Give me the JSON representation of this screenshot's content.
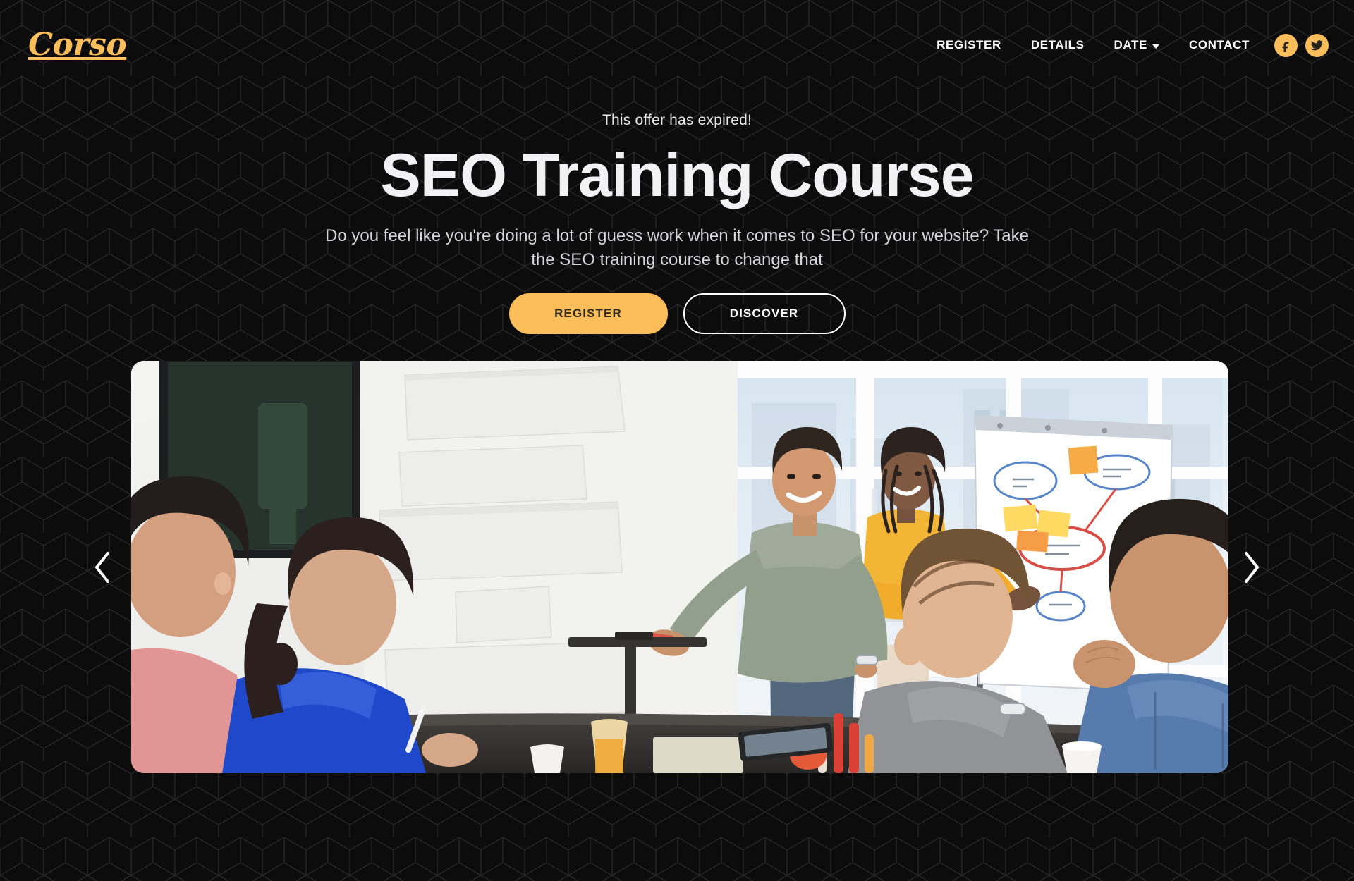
{
  "brand": {
    "name": "Corso",
    "color": "#fcbd5b"
  },
  "nav": {
    "items": [
      {
        "label": "REGISTER",
        "has_dropdown": false
      },
      {
        "label": "DETAILS",
        "has_dropdown": false
      },
      {
        "label": "DATE",
        "has_dropdown": true
      },
      {
        "label": "CONTACT",
        "has_dropdown": false
      }
    ],
    "socials": [
      {
        "name": "facebook",
        "icon": "facebook-icon"
      },
      {
        "name": "twitter",
        "icon": "twitter-icon"
      }
    ]
  },
  "hero": {
    "eyebrow": "This offer has expired!",
    "title": "SEO Training Course",
    "subtitle": "Do you feel like you're doing a lot of guess work when it comes to SEO for your website? Take the SEO training course to change that",
    "primary_button": "REGISTER",
    "secondary_button": "DISCOVER"
  },
  "carousel": {
    "prev_icon": "chevron-left-icon",
    "next_icon": "chevron-right-icon",
    "slide_alt": "Presenter at a flip chart leading an SEO workshop with four seated colleagues in a bright meeting room"
  },
  "theme": {
    "background": "#0c0c0c",
    "pattern_line": "#2a2a2a",
    "accent": "#fcbd5b",
    "text_primary": "#ffffff",
    "text_muted": "#d6d6da"
  }
}
